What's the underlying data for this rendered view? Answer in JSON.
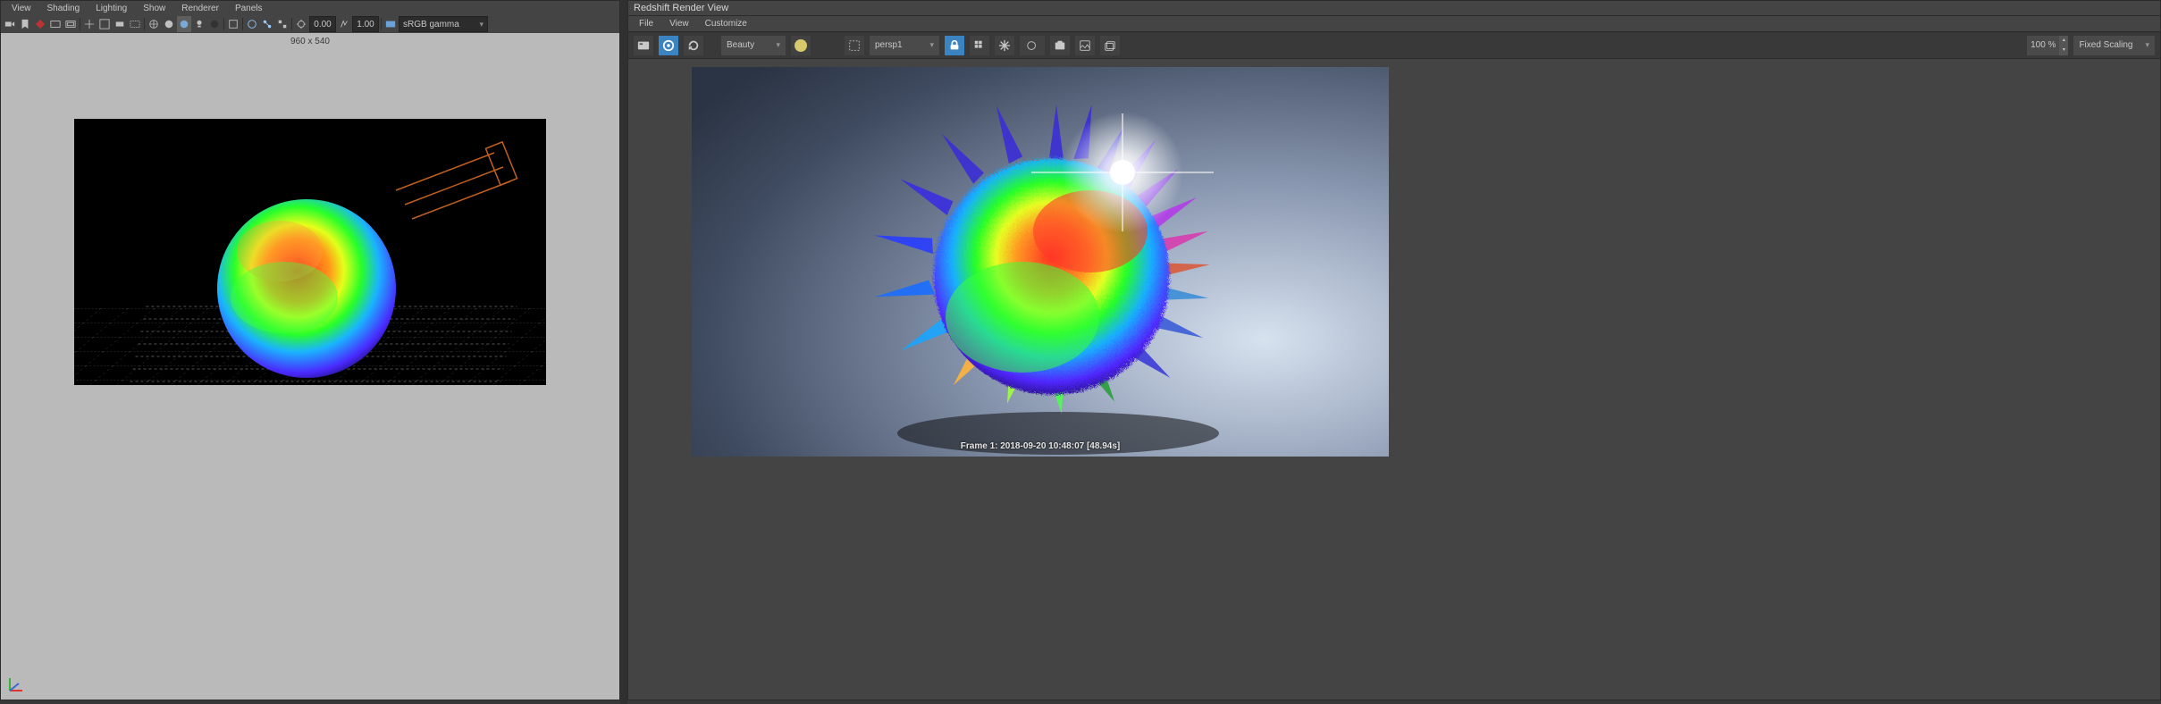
{
  "maya": {
    "menus": {
      "view": "View",
      "shading": "Shading",
      "lighting": "Lighting",
      "show": "Show",
      "renderer": "Renderer",
      "panels": "Panels"
    },
    "toolbar": {
      "gizmo_value": "0.00",
      "scale_value": "1.00",
      "colorspace": "sRGB gamma"
    },
    "viewport": {
      "resolution": "960 x 540"
    }
  },
  "rs": {
    "title": "Redshift Render View",
    "menus": {
      "file": "File",
      "view": "View",
      "customize": "Customize"
    },
    "toolbar": {
      "aov": "Beauty",
      "camera": "persp1",
      "zoom_value": "100 %",
      "scaling_mode": "Fixed Scaling"
    },
    "frameinfo": "Frame    1:   2018-09-20   10:48:07   [48.94s]"
  }
}
